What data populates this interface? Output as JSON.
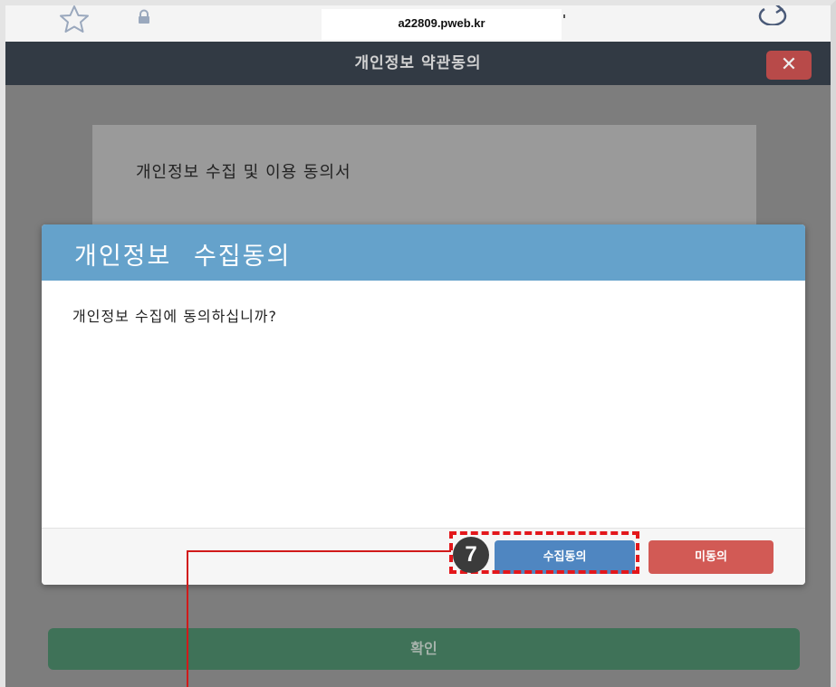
{
  "browser": {
    "url": "a22809.pweb.kr"
  },
  "header": {
    "title": "개인정보 약관동의",
    "close_symbol": "✕"
  },
  "terms": {
    "title": "개인정보 수집 및 이용 동의서"
  },
  "modal": {
    "title": "개인정보  수집동의",
    "message": "개인정보 수집에 동의하십니까?",
    "agree_label": "수집동의",
    "disagree_label": "미동의"
  },
  "annotation": {
    "step_number": "7"
  },
  "confirm": {
    "label": "확인"
  },
  "colors": {
    "header_bg": "#323a44",
    "close_button": "#b84a49",
    "modal_header": "#65a2cb",
    "agree_button": "#4f86c1",
    "disagree_button": "#d25a55",
    "confirm_button": "#3f7258",
    "highlight": "#e3171b"
  }
}
